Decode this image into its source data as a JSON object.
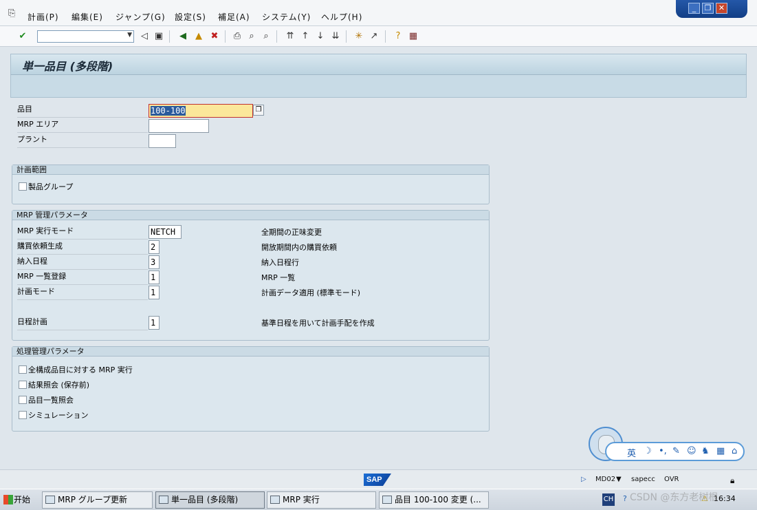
{
  "menu": {
    "items": [
      "計画(P)",
      "編集(E)",
      "ジャンプ(G)",
      "設定(S)",
      "補足(A)",
      "システム(Y)",
      "ヘルプ(H)"
    ]
  },
  "page": {
    "title": "単一品目 (多段階)"
  },
  "header_fields": {
    "material_label": "品目",
    "material_value": "100-100",
    "mrp_area_label": "MRP エリア",
    "mrp_area_value": "",
    "plant_label": "プラント",
    "plant_value": ""
  },
  "scope_group": {
    "title": "計画範囲",
    "product_group_label": "製品グループ"
  },
  "mrp_params": {
    "title": "MRP 管理パラメータ",
    "rows": [
      {
        "label": "MRP 実行モード",
        "value": "NETCH",
        "desc": "全期間の正味変更"
      },
      {
        "label": "購買依頼生成",
        "value": "2",
        "desc": "開放期間内の購買依頼"
      },
      {
        "label": "納入日程",
        "value": "3",
        "desc": "納入日程行"
      },
      {
        "label": "MRP 一覧登録",
        "value": "1",
        "desc": "MRP 一覧"
      },
      {
        "label": "計画モード",
        "value": "1",
        "desc": "計画データ適用 (標準モード)"
      },
      {
        "label": "日程計画",
        "value": "1",
        "desc": "基準日程を用いて計画手配を作成"
      }
    ]
  },
  "process_params": {
    "title": "処理管理パラメータ",
    "options": [
      "全構成品目に対する MRP 実行",
      "結果照会 (保存前)",
      "品目一覧照会",
      "シミュレーション"
    ]
  },
  "ime": {
    "lang": "英"
  },
  "status": {
    "logo": "SAP",
    "transaction": "MD02",
    "server": "sapecc",
    "mode": "OVR"
  },
  "taskbar": {
    "start": "开始",
    "tasks": [
      "MRP グループ更新",
      "単一品目 (多段階)",
      "MRP 実行",
      "品目 100-100 変更 (..."
    ],
    "tray_lang": "CH",
    "clock": "16:34"
  },
  "watermark": "CSDN @东方老树根"
}
